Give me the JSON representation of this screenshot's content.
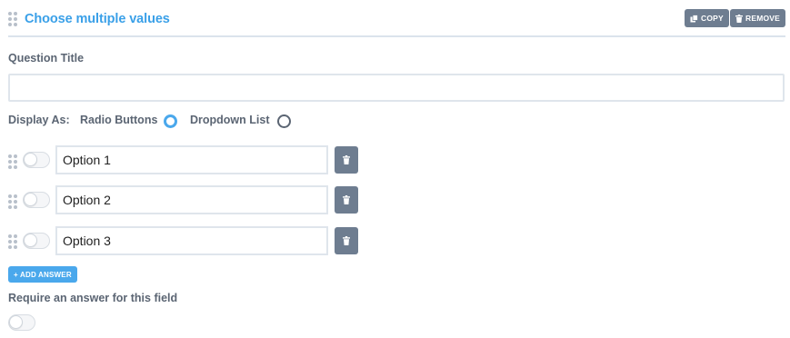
{
  "header": {
    "title": "Choose multiple values",
    "copy_label": "COPY",
    "remove_label": "REMOVE"
  },
  "question": {
    "label": "Question Title",
    "value": ""
  },
  "display": {
    "label": "Display As:",
    "options": [
      {
        "label": "Radio Buttons",
        "selected": true
      },
      {
        "label": "Dropdown List",
        "selected": false
      }
    ]
  },
  "answers": [
    {
      "value": "Option 1",
      "enabled": false
    },
    {
      "value": "Option 2",
      "enabled": false
    },
    {
      "value": "Option 3",
      "enabled": false
    }
  ],
  "add_answer_label": "+ ADD ANSWER",
  "require": {
    "label": "Require an answer for this field",
    "enabled": false
  },
  "colors": {
    "accent": "#3aa0e8",
    "button_gray": "#6e7d90",
    "text": "#5b6573"
  }
}
